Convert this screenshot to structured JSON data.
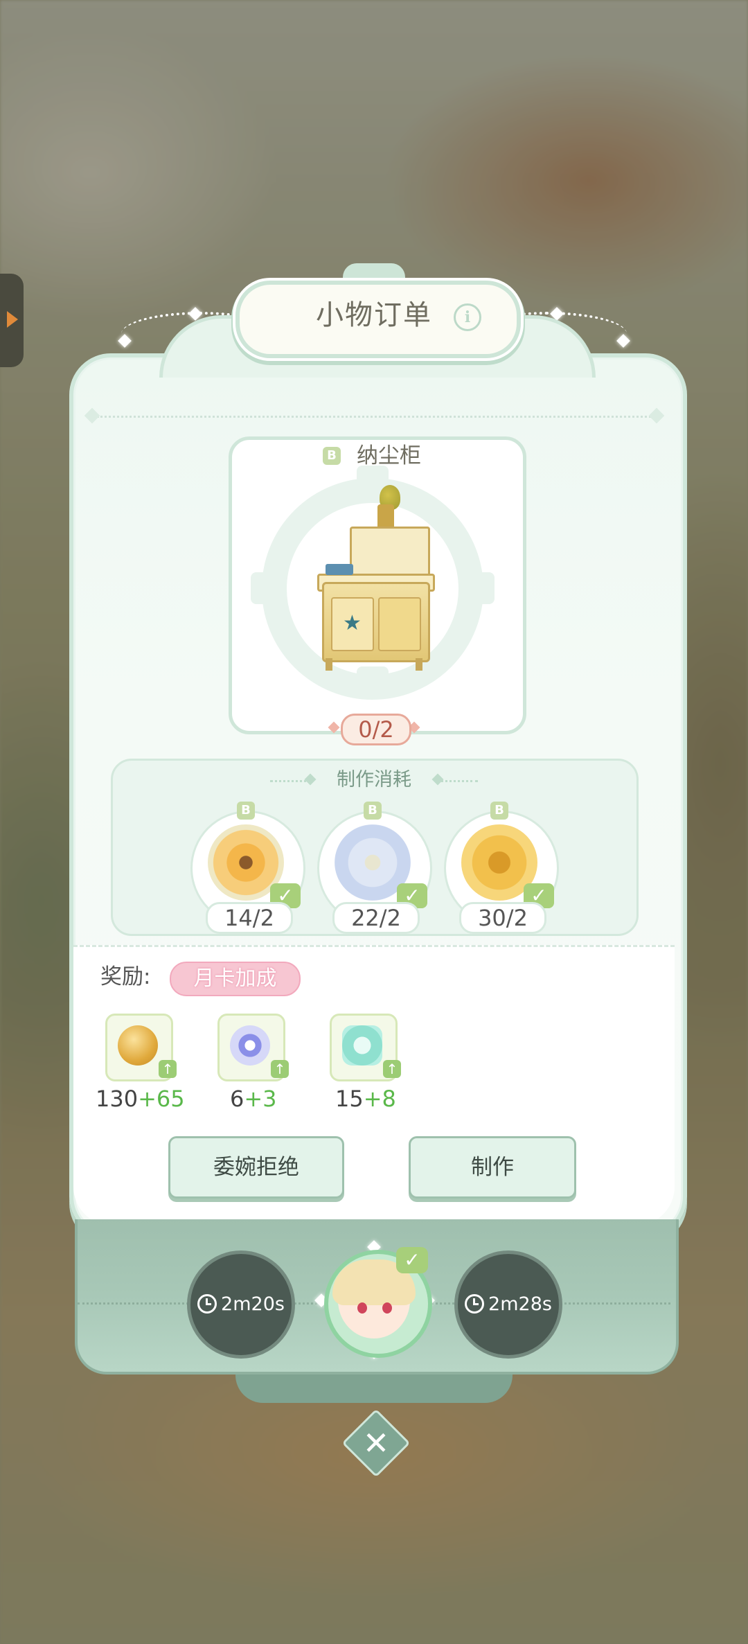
{
  "title": "小物订单",
  "info_icon": "i",
  "item": {
    "grade": "B",
    "name": "纳尘柜",
    "progress": "0/2",
    "icon": "cabinet-furniture"
  },
  "materials": {
    "heading": "制作消耗",
    "items": [
      {
        "grade": "B",
        "icon": "orange-daisy-bouquet",
        "count": "14/2"
      },
      {
        "grade": "B",
        "icon": "white-lily-bouquet",
        "count": "22/2"
      },
      {
        "grade": "B",
        "icon": "golden-rose",
        "count": "30/2"
      }
    ]
  },
  "reward": {
    "label": "奖励:",
    "bonus_tag": "月卡加成",
    "items": [
      {
        "icon": "house-coin",
        "base": "130",
        "bonus": "+65"
      },
      {
        "icon": "blue-crystal-token",
        "base": "6",
        "bonus": "+3"
      },
      {
        "icon": "exp-star",
        "base": "15",
        "bonus": "+8"
      }
    ]
  },
  "buttons": {
    "decline": "委婉拒绝",
    "craft": "制作"
  },
  "queue": {
    "left_timer": "2m20s",
    "right_timer": "2m28s"
  },
  "colors": {
    "accent_green": "#a8d07a",
    "bonus_green": "#5ab84a",
    "pill_pink": "#f7c6d2",
    "progress_red": "#b45a4a"
  }
}
